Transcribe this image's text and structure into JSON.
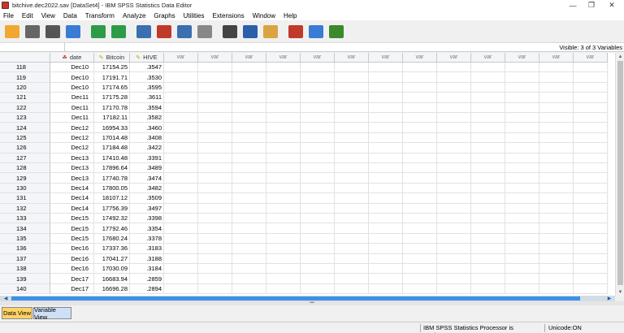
{
  "window": {
    "title": "bitchive.dec2022.sav [DataSet4] - IBM SPSS Statistics Data Editor",
    "controls": [
      "—",
      "❐",
      "✕"
    ]
  },
  "menu": [
    "File",
    "Edit",
    "View",
    "Data",
    "Transform",
    "Analyze",
    "Graphs",
    "Utilities",
    "Extensions",
    "Window",
    "Help"
  ],
  "toolbar": [
    {
      "name": "open-data-icon",
      "color": "#f0a830"
    },
    {
      "name": "save-icon",
      "color": "#666666"
    },
    {
      "name": "print-icon",
      "color": "#555555"
    },
    {
      "name": "recall-dialog-icon",
      "color": "#3a7bd5"
    },
    {
      "name": "undo-icon",
      "color": "#2e9b49"
    },
    {
      "name": "redo-icon",
      "color": "#2e9b49"
    },
    {
      "name": "goto-case-icon",
      "color": "#3a6fb0"
    },
    {
      "name": "goto-variable-icon",
      "color": "#c0392b"
    },
    {
      "name": "variables-icon",
      "color": "#3a6fb0"
    },
    {
      "name": "run-descriptives-icon",
      "color": "#888888"
    },
    {
      "name": "find-icon",
      "color": "#444444"
    },
    {
      "name": "split-file-icon",
      "color": "#2d5ea8"
    },
    {
      "name": "select-cases-icon",
      "color": "#d9a441"
    },
    {
      "name": "value-labels-icon",
      "color": "#c0392b"
    },
    {
      "name": "use-sets-icon",
      "color": "#3a7bd5"
    },
    {
      "name": "spell-check-icon",
      "color": "#3b8a2a"
    }
  ],
  "editbar": {
    "visible": "Visible: 3 of 3 Variables"
  },
  "columns": [
    {
      "label": "date",
      "icon": "☘",
      "icon_color": "#c0392b",
      "width": 54
    },
    {
      "label": "Bitcoin",
      "icon": "✎",
      "icon_color": "#c8a000",
      "width": 44
    },
    {
      "label": "HIVE",
      "icon": "✎",
      "icon_color": "#c8a000",
      "width": 42
    }
  ],
  "empty_column_label": "var",
  "empty_column_count": 13,
  "rows": [
    [
      "118",
      "Dec10",
      "17154.25",
      ".3547"
    ],
    [
      "119",
      "Dec10",
      "17191.71",
      ".3530"
    ],
    [
      "120",
      "Dec10",
      "17174.65",
      ".3595"
    ],
    [
      "121",
      "Dec11",
      "17175.28",
      ".3611"
    ],
    [
      "122",
      "Dec11",
      "17170.78",
      ".3594"
    ],
    [
      "123",
      "Dec11",
      "17182.11",
      ".3582"
    ],
    [
      "124",
      "Dec12",
      "16954.33",
      ".3460"
    ],
    [
      "125",
      "Dec12",
      "17014.48",
      ".3408"
    ],
    [
      "126",
      "Dec12",
      "17184.48",
      ".3422"
    ],
    [
      "127",
      "Dec13",
      "17410.48",
      ".3391"
    ],
    [
      "128",
      "Dec13",
      "17896.64",
      ".3489"
    ],
    [
      "129",
      "Dec13",
      "17740.78",
      ".3474"
    ],
    [
      "130",
      "Dec14",
      "17800.05",
      ".3482"
    ],
    [
      "131",
      "Dec14",
      "18107.12",
      ".3509"
    ],
    [
      "132",
      "Dec14",
      "17756.39",
      ".3497"
    ],
    [
      "133",
      "Dec15",
      "17492.32",
      ".3398"
    ],
    [
      "134",
      "Dec15",
      "17792.46",
      ".3354"
    ],
    [
      "135",
      "Dec15",
      "17680.24",
      ".3378"
    ],
    [
      "136",
      "Dec16",
      "17337.36",
      ".3183"
    ],
    [
      "137",
      "Dec16",
      "17041.27",
      ".3188"
    ],
    [
      "138",
      "Dec16",
      "17030.09",
      ".3184"
    ],
    [
      "139",
      "Dec17",
      "16683.94",
      ".2859"
    ],
    [
      "140",
      "Dec17",
      "16696.28",
      ".2894"
    ]
  ],
  "tabs": {
    "data_view": "Data View",
    "variable_view": "Variable View"
  },
  "status": {
    "processor": "IBM SPSS Statistics Processor is ready",
    "unicode": "Unicode:ON"
  }
}
